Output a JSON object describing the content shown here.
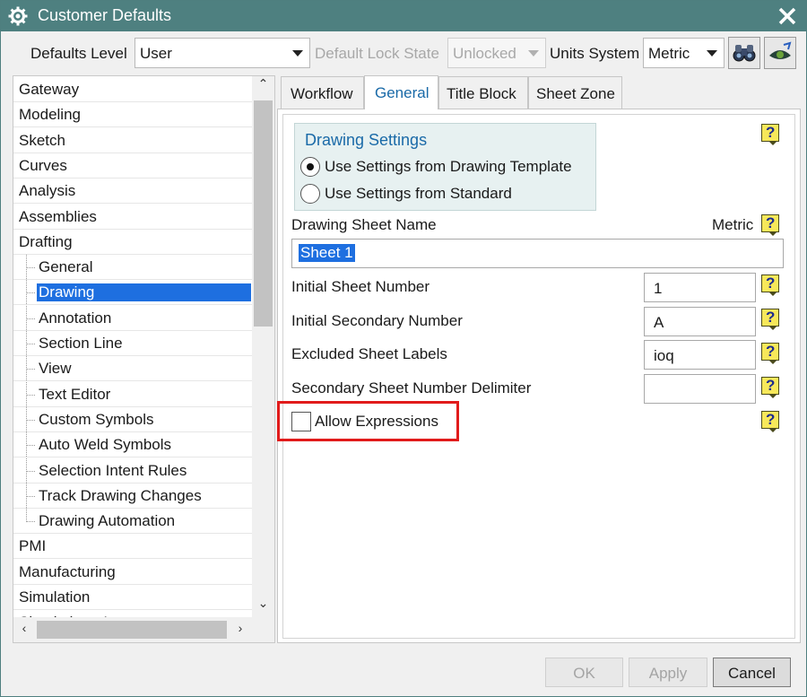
{
  "window": {
    "title": "Customer Defaults",
    "title_bar_color": "#4e8080"
  },
  "toolbar": {
    "defaults_level_label": "Defaults Level",
    "defaults_level_value": "User",
    "default_lock_state_label": "Default Lock State",
    "default_lock_state_value": "Unlocked",
    "units_system_label": "Units System",
    "units_system_value": "Metric",
    "find_icon": "binoculars-icon",
    "manage_icon": "dark-eye-icon"
  },
  "tree": {
    "items": [
      {
        "label": "Gateway"
      },
      {
        "label": "Modeling"
      },
      {
        "label": "Sketch"
      },
      {
        "label": "Curves"
      },
      {
        "label": "Analysis"
      },
      {
        "label": "Assemblies"
      },
      {
        "label": "Drafting"
      },
      {
        "label": "General"
      },
      {
        "label": "Drawing"
      },
      {
        "label": "Annotation"
      },
      {
        "label": "Section Line"
      },
      {
        "label": "View"
      },
      {
        "label": "Text Editor"
      },
      {
        "label": "Custom Symbols"
      },
      {
        "label": "Auto Weld Symbols"
      },
      {
        "label": "Selection Intent Rules"
      },
      {
        "label": "Track Drawing Changes"
      },
      {
        "label": "Drawing Automation"
      },
      {
        "label": "PMI"
      },
      {
        "label": "Manufacturing"
      },
      {
        "label": "Simulation"
      },
      {
        "label": "Simulation - Layout"
      }
    ],
    "selected": "Drawing",
    "selected_color": "#1e6fe0"
  },
  "tabs": [
    {
      "label": "Workflow"
    },
    {
      "label": "General"
    },
    {
      "label": "Title Block"
    },
    {
      "label": "Sheet Zone"
    }
  ],
  "active_tab": "General",
  "drawing_settings": {
    "title": "Drawing Settings",
    "option_template": "Use Settings from Drawing Template",
    "option_standard": "Use Settings from Standard",
    "selected": "template"
  },
  "form": {
    "drawing_sheet_name_label": "Drawing Sheet Name",
    "units_label": "Metric",
    "drawing_sheet_name_value": "Sheet 1",
    "initial_sheet_number_label": "Initial Sheet Number",
    "initial_sheet_number_value": "1",
    "initial_secondary_number_label": "Initial Secondary Number",
    "initial_secondary_number_value": "A",
    "excluded_sheet_labels_label": "Excluded Sheet Labels",
    "excluded_sheet_labels_value": "ioq",
    "secondary_sheet_number_delimiter_label": "Secondary Sheet Number Delimiter",
    "secondary_sheet_number_delimiter_value": "",
    "allow_expressions_label": "Allow Expressions",
    "allow_expressions_checked": false,
    "help_glyph": "?"
  },
  "buttons": {
    "ok": "OK",
    "apply": "Apply",
    "cancel": "Cancel"
  },
  "highlight_color": "#e11b1b"
}
